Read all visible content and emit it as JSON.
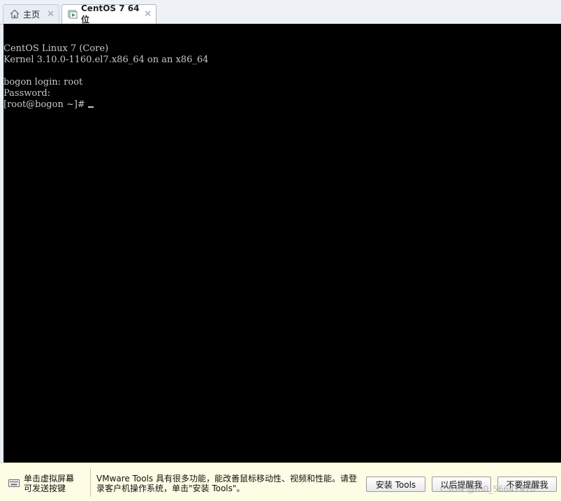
{
  "tabs": [
    {
      "label": "主页",
      "icon": "home-icon"
    },
    {
      "label": "CentOS 7 64 位",
      "icon": "vm-power-icon"
    }
  ],
  "console": {
    "lines": [
      "CentOS Linux 7 (Core)",
      "Kernel 3.10.0-1160.el7.x86_64 on an x86_64",
      "",
      "bogon login: root",
      "Password:",
      "[root@bogon ~]# "
    ]
  },
  "infobar": {
    "tip_line1": "单击虚拟屏幕",
    "tip_line2": "可发送按键",
    "message_line1": "VMware Tools 具有很多功能，能改善鼠标移动性、视频和性能。请登",
    "message_line2": "录客户机操作系统，单击\"安装 Tools\"。",
    "buttons": {
      "install": "安装 Tools",
      "later": "以后提醒我",
      "never": "不要提醒我"
    }
  },
  "watermark": "CSDN @m0_56647418",
  "colors": {
    "console_bg": "#000000",
    "console_text": "#c8c8c8",
    "infobar_bg": "#fdfce4"
  }
}
